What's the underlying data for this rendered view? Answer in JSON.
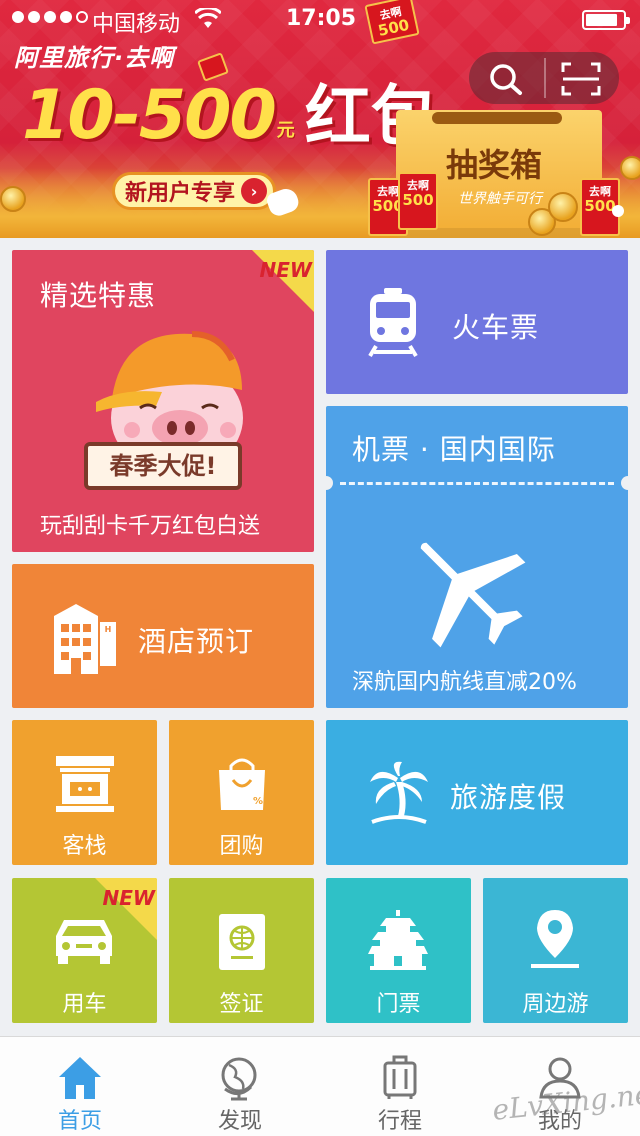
{
  "status_bar": {
    "carrier": "中国移动",
    "time": "17:05",
    "battery_level": 0.85
  },
  "banner": {
    "brand": "阿里旅行·去啊",
    "amount": "10-500",
    "unit_left": "元",
    "unit_right": "元",
    "hongbao": "红包",
    "new_user_button": "新用户专享",
    "box_title": "抽奖箱",
    "box_slogan": "世界触手可行",
    "card_brand": "去啊",
    "card_value": "500"
  },
  "tiles": {
    "jingxuan": {
      "label": "精选特惠",
      "badge": "NEW",
      "promo": "春季大促!",
      "subtitle": "玩刮刮卡千万红包白送",
      "color": "#e0455f"
    },
    "train": {
      "label": "火车票",
      "color": "#6f76e0"
    },
    "flight": {
      "label": "机票 · 国内国际",
      "subtitle": "深航国内航线直减20%",
      "color": "#4fa2e8"
    },
    "hotel": {
      "label": "酒店预订",
      "color": "#f08538"
    },
    "inn": {
      "label": "客栈",
      "color": "#f0a12e"
    },
    "group": {
      "label": "团购",
      "color": "#f0a12e"
    },
    "vacation": {
      "label": "旅游度假",
      "color": "#3aaee2"
    },
    "car": {
      "label": "用车",
      "badge": "NEW",
      "color": "#b4c634"
    },
    "visa": {
      "label": "签证",
      "color": "#b4c634"
    },
    "tickets": {
      "label": "门票",
      "color": "#2fc1c7"
    },
    "nearby": {
      "label": "周边游",
      "color": "#3bb6d4"
    }
  },
  "tab_bar": {
    "items": [
      {
        "label": "首页",
        "icon": "home-icon",
        "active": true
      },
      {
        "label": "发现",
        "icon": "globe-icon",
        "active": false
      },
      {
        "label": "行程",
        "icon": "suitcase-icon",
        "active": false
      },
      {
        "label": "我的",
        "icon": "user-icon",
        "active": false
      }
    ],
    "active_color": "#3c9ee5"
  },
  "watermark": "eLvXing.net"
}
